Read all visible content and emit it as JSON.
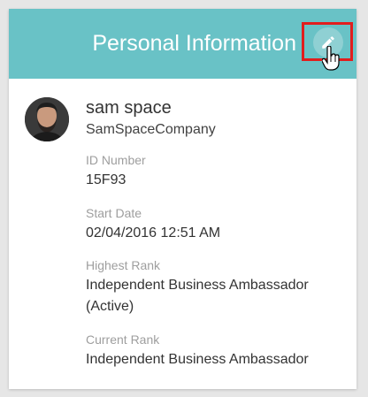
{
  "header": {
    "title": "Personal Information",
    "edit_icon": "pencil-icon",
    "accent_color": "#69c2c6",
    "highlight_color": "#e11d1d"
  },
  "profile": {
    "name": "sam space",
    "company": "SamSpaceCompany",
    "avatar_icon": "user-avatar"
  },
  "fields": [
    {
      "label": "ID Number",
      "value": "15F93"
    },
    {
      "label": "Start Date",
      "value": "02/04/2016 12:51 AM"
    },
    {
      "label": "Highest Rank",
      "value": "Independent Business Ambassador (Active)"
    },
    {
      "label": "Current Rank",
      "value": "Independent Business Ambassador"
    }
  ]
}
